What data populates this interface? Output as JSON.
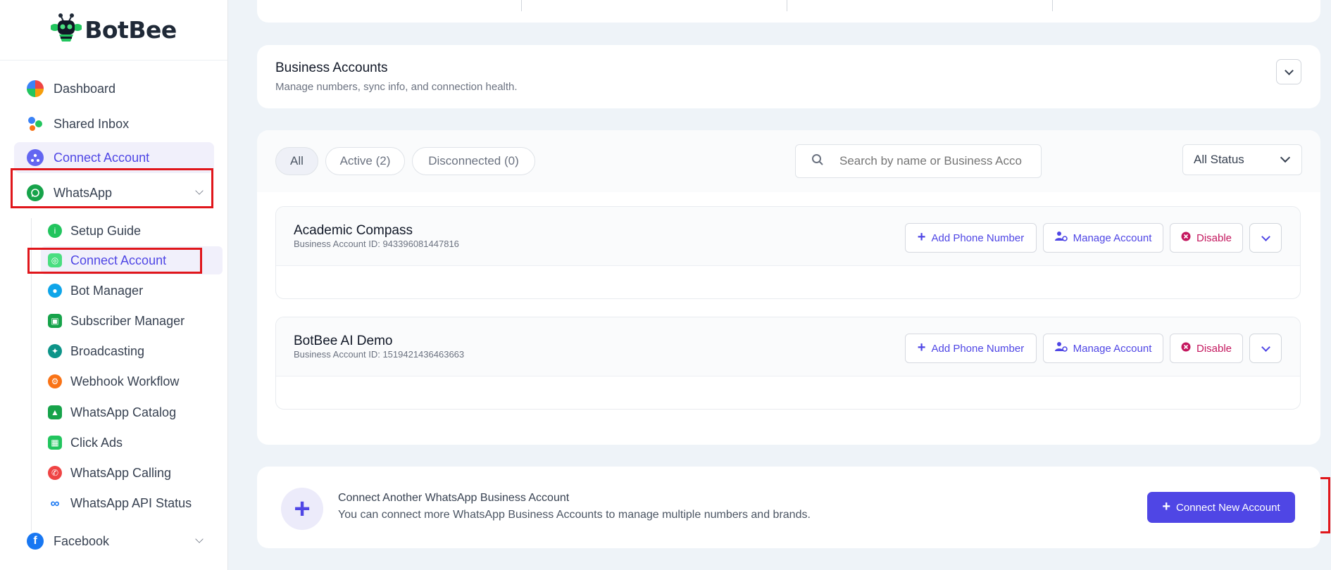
{
  "brand": {
    "name": "BotBee"
  },
  "sidebar": {
    "items": [
      {
        "label": "Dashboard",
        "icon": "dashboard-icon"
      },
      {
        "label": "Shared Inbox",
        "icon": "shared-inbox-icon"
      },
      {
        "label": "Connect Account",
        "icon": "connect-account-icon",
        "active": true
      },
      {
        "label": "WhatsApp",
        "icon": "whatsapp-icon",
        "expanded": true
      },
      {
        "label": "Facebook",
        "icon": "facebook-icon"
      }
    ],
    "whatsapp_sub": [
      {
        "label": "Setup Guide",
        "icon": "info-icon"
      },
      {
        "label": "Connect Account",
        "icon": "whatsapp-connect-icon",
        "active": true
      },
      {
        "label": "Bot Manager",
        "icon": "bot-icon"
      },
      {
        "label": "Subscriber Manager",
        "icon": "subscriber-icon"
      },
      {
        "label": "Broadcasting",
        "icon": "broadcast-icon"
      },
      {
        "label": "Webhook Workflow",
        "icon": "webhook-icon"
      },
      {
        "label": "WhatsApp Catalog",
        "icon": "catalog-icon"
      },
      {
        "label": "Click Ads",
        "icon": "ads-icon"
      },
      {
        "label": "WhatsApp Calling",
        "icon": "calling-icon"
      },
      {
        "label": "WhatsApp API Status",
        "icon": "meta-icon"
      }
    ]
  },
  "business_accounts": {
    "title": "Business Accounts",
    "subtitle": "Manage numbers, sync info, and connection health."
  },
  "filters": {
    "tabs": [
      "All",
      "Active (2)",
      "Disconnected (0)"
    ],
    "search_placeholder": "Search by name or Business Account ID",
    "status_select": "All Status"
  },
  "accounts": [
    {
      "name": "Academic Compass",
      "id_text": "Business Account ID: 943396081447816"
    },
    {
      "name": "BotBee AI Demo",
      "id_text": "Business Account ID: 1519421436463663"
    }
  ],
  "account_actions": {
    "add_phone": "Add Phone Number",
    "manage": "Manage Account",
    "disable": "Disable"
  },
  "connect_another": {
    "title": "Connect Another WhatsApp Business Account",
    "subtitle": "You can connect more WhatsApp Business Accounts to manage multiple numbers and brands.",
    "button": "Connect New Account"
  },
  "colors": {
    "accent": "#4f46e5",
    "danger": "#c4185f",
    "highlight": "#e0161b"
  }
}
